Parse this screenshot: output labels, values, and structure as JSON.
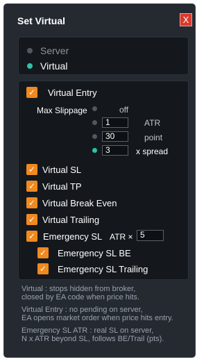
{
  "window": {
    "title": "Set Virtual",
    "close_label": "X"
  },
  "mode": {
    "options": [
      {
        "label": "Server",
        "selected": false
      },
      {
        "label": "Virtual",
        "selected": true
      }
    ]
  },
  "virtual_entry": {
    "label": "Virtual Entry",
    "checked": true,
    "check_glyph": "✓"
  },
  "max_slippage": {
    "label": "Max Slippage",
    "options": [
      {
        "label": "off",
        "value": "",
        "selected": false
      },
      {
        "label": "ATR",
        "value": "1",
        "selected": false
      },
      {
        "label": "point",
        "value": "30",
        "selected": false
      },
      {
        "label": "x spread",
        "value": "3",
        "selected": true
      }
    ]
  },
  "checks": [
    {
      "label": "Virtual SL",
      "checked": true
    },
    {
      "label": "Virtual TP",
      "checked": true
    },
    {
      "label": "Virtual Break Even",
      "checked": true
    },
    {
      "label": "Virtual Trailing",
      "checked": true
    }
  ],
  "emergency_sl": {
    "label": "Emergency SL",
    "checked": true,
    "atr_label": "ATR ×",
    "atr_value": "5"
  },
  "sub_checks": [
    {
      "label": "Emergency SL BE",
      "checked": true
    },
    {
      "label": "Emergency SL Trailing",
      "checked": true
    }
  ],
  "notes": [
    "Virtual : stops hidden from broker,",
    "closed by EA code when price hits.",
    "Virtual Entry : no pending on server,",
    "EA opens market order when price hits entry.",
    "Emergency SL ATR : real SL on server,",
    "N x ATR beyond SL, follows BE/Trail (pts)."
  ],
  "colors": {
    "accent": "#f0891f",
    "radio_on": "#2ec2a6",
    "close": "#d93a2e"
  }
}
